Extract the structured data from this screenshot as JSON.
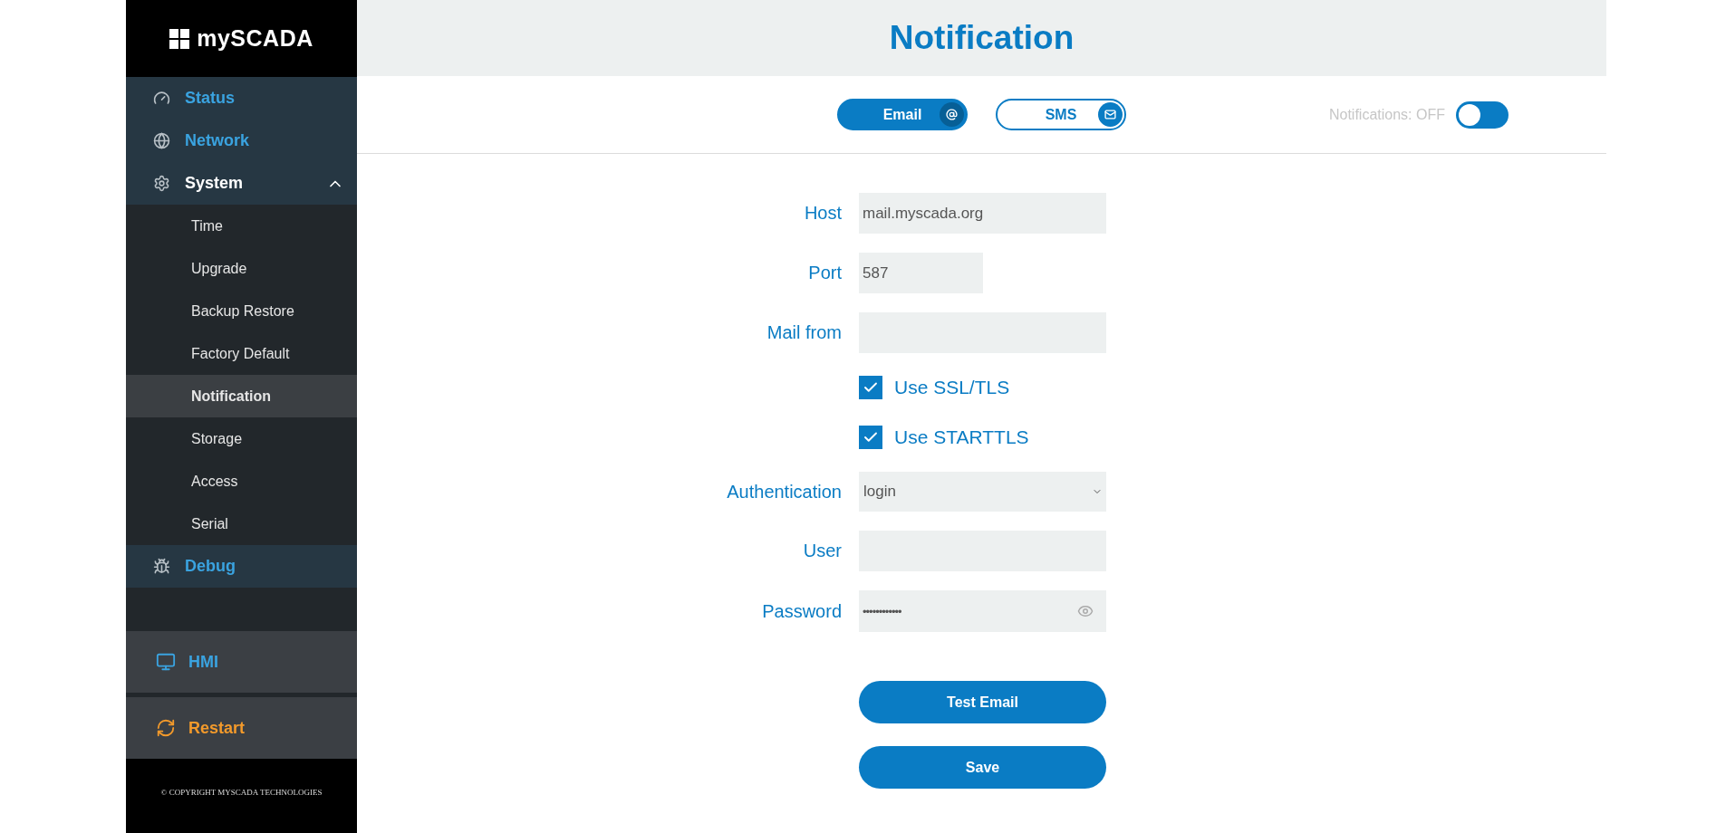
{
  "logo": {
    "text": "mySCADA"
  },
  "sidebar": {
    "sections": [
      {
        "label": "Status",
        "kind": "gauge",
        "expanded": false
      },
      {
        "label": "Network",
        "kind": "globe",
        "expanded": false
      },
      {
        "label": "System",
        "kind": "gear",
        "expanded": true,
        "children": [
          {
            "label": "Time",
            "selected": false
          },
          {
            "label": "Upgrade",
            "selected": false
          },
          {
            "label": "Backup Restore",
            "selected": false
          },
          {
            "label": "Factory Default",
            "selected": false
          },
          {
            "label": "Notification",
            "selected": true
          },
          {
            "label": "Storage",
            "selected": false
          },
          {
            "label": "Access",
            "selected": false
          },
          {
            "label": "Serial",
            "selected": false
          }
        ]
      },
      {
        "label": "Debug",
        "kind": "bug",
        "expanded": false
      }
    ],
    "bottom_links": [
      {
        "label": "HMI",
        "kind": "hmi"
      },
      {
        "label": "Restart",
        "kind": "restart"
      }
    ],
    "footer": "© COPYRIGHT MYSCADA TECHNOLOGIES"
  },
  "header": {
    "title": "Notification"
  },
  "tabs": [
    {
      "label": "Email",
      "kind": "email",
      "selected": true
    },
    {
      "label": "SMS",
      "kind": "sms",
      "selected": false
    }
  ],
  "notifications_toggle": {
    "label": "Notifications: OFF",
    "on": false
  },
  "form": {
    "fields": [
      {
        "kind": "text",
        "label": "Host",
        "value": "mail.myscada.org"
      },
      {
        "kind": "number",
        "label": "Port",
        "value": "587"
      },
      {
        "kind": "text",
        "label": "Mail from"
      },
      {
        "kind": "checkbox",
        "label": "Use SSL/TLS",
        "checked": true
      },
      {
        "kind": "checkbox",
        "label": "Use STARTTLS",
        "checked": true
      },
      {
        "kind": "select",
        "label": "Authentication",
        "value": "login"
      },
      {
        "kind": "text",
        "label": "User"
      },
      {
        "kind": "password",
        "label": "Password",
        "value": "••••••••••••"
      }
    ],
    "buttons": [
      "Test Email",
      "Save"
    ]
  }
}
